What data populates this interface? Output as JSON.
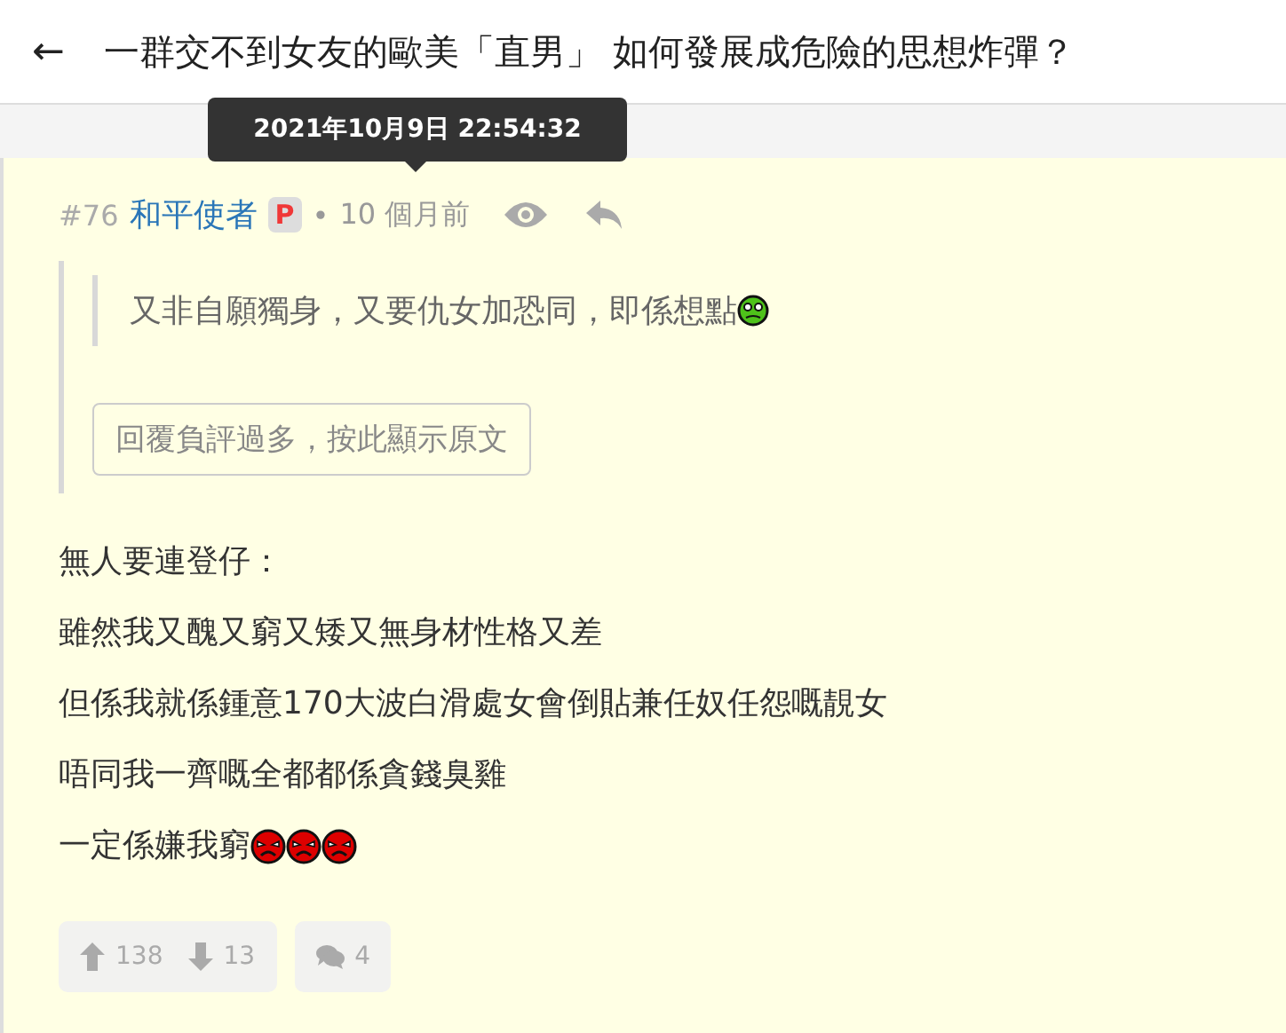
{
  "header": {
    "back": "←",
    "title": "一群交不到女友的歐美「直男」 如何發展成危險的思想炸彈？"
  },
  "tooltip": "2021年10月9日 22:54:32",
  "post": {
    "number": "#76",
    "author": "和平使者",
    "badge": "P",
    "separator": "•",
    "time": "10 個月前",
    "quote": {
      "text": "又非自願獨身，又要仇女加恐同，即係想點",
      "emoji": [
        {
          "kind": "confused"
        }
      ]
    },
    "show_original": "回覆負評過多，按此顯示原文",
    "lines": [
      {
        "text": "無人要連登仔："
      },
      {
        "text": "雖然我又醜又窮又矮又無身材性格又差"
      },
      {
        "text": "但係我就係鍾意170大波白滑處女會倒貼兼任奴任怨嘅靚女"
      },
      {
        "text": "唔同我一齊嘅全都都係貪錢臭雞"
      },
      {
        "text": "一定係嫌我窮",
        "emoji": [
          {
            "kind": "angry"
          },
          {
            "kind": "angry"
          },
          {
            "kind": "angry"
          }
        ]
      }
    ],
    "upvotes": "138",
    "downvotes": "13",
    "replies": "4"
  }
}
